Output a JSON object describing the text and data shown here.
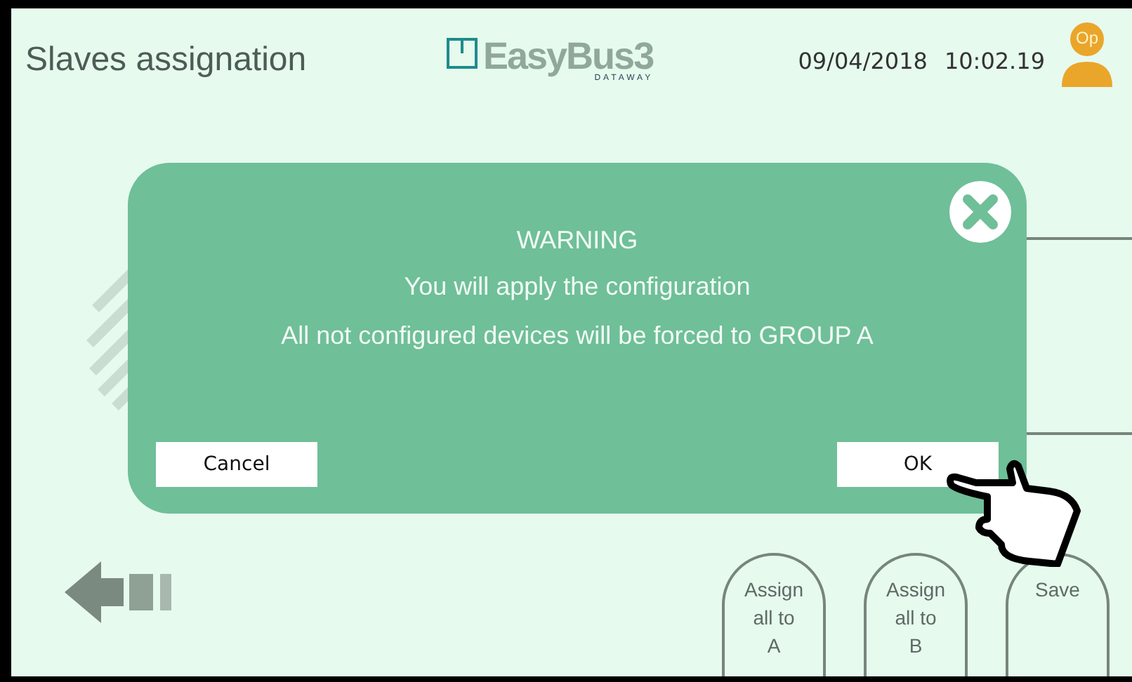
{
  "header": {
    "title": "Slaves assignation",
    "logo": {
      "name": "EasyBus3",
      "maker": "DATAWAY"
    },
    "date": "09/04/2018",
    "time": "10:02.19",
    "user": "Op"
  },
  "dialog": {
    "title": "WARNING",
    "lines": [
      "You will apply the configuration",
      "All not configured devices will be forced to GROUP A"
    ],
    "buttons": [
      {
        "label": "Cancel"
      },
      {
        "label": "OK"
      }
    ]
  },
  "actions": [
    {
      "lines": [
        "Assign",
        "all to",
        "A"
      ]
    },
    {
      "lines": [
        "Assign",
        "all to",
        "B"
      ]
    },
    {
      "lines": [
        "Save"
      ]
    }
  ]
}
